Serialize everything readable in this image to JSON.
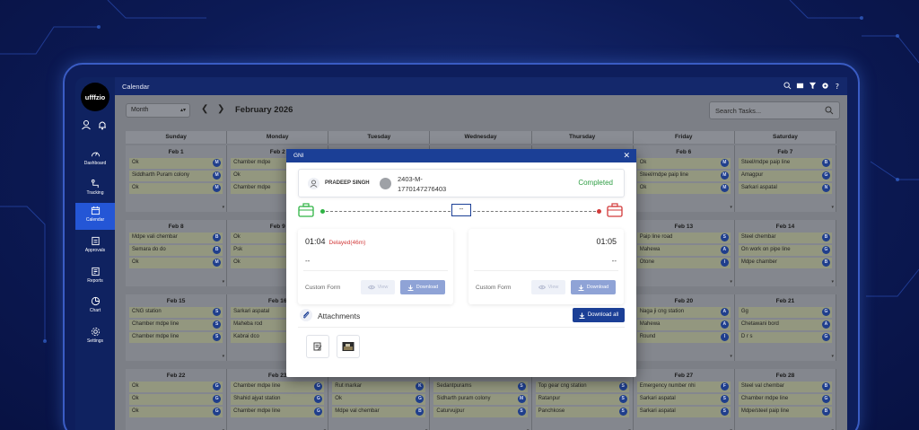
{
  "app": {
    "logo": "ufffzio",
    "title": "Calendar"
  },
  "sidebar": {
    "items": [
      {
        "label": "Dashboard",
        "icon": "gauge-icon"
      },
      {
        "label": "Tracking",
        "icon": "route-icon"
      },
      {
        "label": "Calendar",
        "icon": "calendar-icon",
        "active": true
      },
      {
        "label": "Approvals",
        "icon": "approvals-icon"
      },
      {
        "label": "Reports",
        "icon": "report-icon"
      },
      {
        "label": "Chart",
        "icon": "pie-chart-icon"
      },
      {
        "label": "Settings",
        "icon": "gear-icon"
      }
    ]
  },
  "toolbar": {
    "view_select": "Month",
    "month_title": "February 2026",
    "search_placeholder": "Search Tasks..."
  },
  "calendar": {
    "weekdays": [
      "Sunday",
      "Monday",
      "Tuesday",
      "Wednesday",
      "Thursday",
      "Friday",
      "Saturday"
    ],
    "weeks": [
      [
        {
          "day": "Feb 1",
          "events": [
            [
              "Ok",
              "M"
            ],
            [
              "Siddharth Puram colony",
              "M"
            ],
            [
              "Ok",
              "M"
            ]
          ]
        },
        {
          "day": "Feb 2",
          "events": [
            [
              "Chamber mdpe",
              "M"
            ],
            [
              "Ok",
              "M"
            ],
            [
              "Chamber mdpe",
              "M"
            ]
          ]
        },
        {
          "day": "",
          "events": []
        },
        {
          "day": "",
          "events": []
        },
        {
          "day": "",
          "events": []
        },
        {
          "day": "Feb 6",
          "events": [
            [
              "Ok",
              "M"
            ],
            [
              "Steel/mdpe paip line",
              "M"
            ],
            [
              "Ok",
              "M"
            ]
          ]
        },
        {
          "day": "Feb 7",
          "events": [
            [
              "Steel/mdpe paip line",
              "B"
            ],
            [
              "Amagpur",
              "G"
            ],
            [
              "Sarkari aspatal",
              "N"
            ]
          ]
        }
      ],
      [
        {
          "day": "Feb 8",
          "events": [
            [
              "Mdpe vali chembar",
              "B"
            ],
            [
              "Semara do do",
              "B"
            ],
            [
              "Ok",
              "M"
            ]
          ]
        },
        {
          "day": "Feb 9",
          "events": [
            [
              "Ok",
              "M"
            ],
            [
              "Psk",
              "M"
            ],
            [
              "Ok",
              "M"
            ]
          ]
        },
        {
          "day": "",
          "events": []
        },
        {
          "day": "",
          "events": []
        },
        {
          "day": "",
          "events": []
        },
        {
          "day": "Feb 13",
          "events": [
            [
              "Paip line road",
              "S"
            ],
            [
              "Mahewa",
              "A"
            ],
            [
              "Otone",
              "I"
            ]
          ]
        },
        {
          "day": "Feb 14",
          "events": [
            [
              "Steel chembar",
              "B"
            ],
            [
              "On work on pipe line",
              "G"
            ],
            [
              "Mdpe chamber",
              "B"
            ]
          ]
        }
      ],
      [
        {
          "day": "Feb 15",
          "events": [
            [
              "CNG station",
              "S"
            ],
            [
              "Chamber mdpe line",
              "S"
            ],
            [
              "Chamber mdpe line",
              "S"
            ]
          ]
        },
        {
          "day": "Feb 16",
          "events": [
            [
              "Sarkari aspatal",
              "S"
            ],
            [
              "Maheba rod",
              "S"
            ],
            [
              "Kabrai dco",
              "S"
            ]
          ]
        },
        {
          "day": "",
          "events": []
        },
        {
          "day": "",
          "events": []
        },
        {
          "day": "",
          "events": []
        },
        {
          "day": "Feb 20",
          "events": [
            [
              "Naga ji cng station",
              "A"
            ],
            [
              "Mahewa",
              "A"
            ],
            [
              "Round",
              "I"
            ]
          ]
        },
        {
          "day": "Feb 21",
          "events": [
            [
              "Gg",
              "G"
            ],
            [
              "Chetawani bord",
              "A"
            ],
            [
              "D r s",
              "G"
            ]
          ]
        }
      ],
      [
        {
          "day": "Feb 22",
          "events": [
            [
              "Ok",
              "G"
            ],
            [
              "Ok",
              "G"
            ],
            [
              "Ok",
              "G"
            ]
          ]
        },
        {
          "day": "Feb 23",
          "events": [
            [
              "Chamber mdpe line",
              "G"
            ],
            [
              "Shahid ajyat station",
              "G"
            ],
            [
              "Chamber mdpe line",
              "G"
            ]
          ]
        },
        {
          "day": "Feb 24",
          "events": [
            [
              "Rut markar",
              "K"
            ],
            [
              "Ok",
              "G"
            ],
            [
              "Mdpe val chembar",
              "B"
            ]
          ]
        },
        {
          "day": "Feb 25",
          "events": [
            [
              "Sedantpurams",
              "S"
            ],
            [
              "Sidharth puram colony",
              "M"
            ],
            [
              "Caturvujpur",
              "S"
            ]
          ]
        },
        {
          "day": "Feb 26",
          "events": [
            [
              "Top gear cng station",
              "S"
            ],
            [
              "Ratanpur",
              "S"
            ],
            [
              "Panchkose",
              "S"
            ]
          ]
        },
        {
          "day": "Feb 27",
          "events": [
            [
              "Emergency number nhi",
              "F"
            ],
            [
              "Sarkari aspatal",
              "S"
            ],
            [
              "Sarkari aspatal",
              "S"
            ]
          ]
        },
        {
          "day": "Feb 28",
          "events": [
            [
              "Steel val chembar",
              "B"
            ],
            [
              "Chamber mdpe line",
              "G"
            ],
            [
              "Mdpe/steel paip line",
              "B"
            ]
          ]
        }
      ]
    ]
  },
  "modal": {
    "title": "GNI",
    "user_name": "PRADEEP SINGH",
    "ticket_id": "2403-M-1770147276403",
    "status": "Completed",
    "middle_value": "--",
    "start": {
      "time": "01:04",
      "delay": "Delayed(46m)",
      "note": "--",
      "form_label": "Custom Form",
      "view_label": "View",
      "download_label": "Download"
    },
    "end": {
      "time": "01:05",
      "note": "--",
      "form_label": "Custom Form",
      "view_label": "View",
      "download_label": "Download"
    },
    "attachments_title": "Attachments",
    "download_all_label": "Download all",
    "colors": {
      "status": "#2f9e44",
      "delay": "#d23a3a",
      "primary": "#1b3f96"
    }
  }
}
